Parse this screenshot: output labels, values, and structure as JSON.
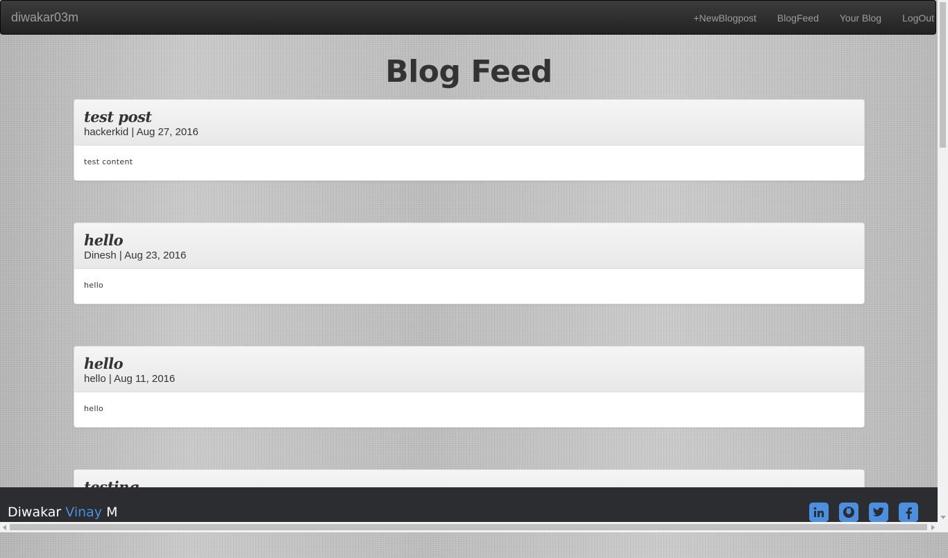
{
  "navbar": {
    "brand": "diwakar03m",
    "links": [
      {
        "label": "+NewBlogpost"
      },
      {
        "label": "BlogFeed"
      },
      {
        "label": "Your Blog"
      },
      {
        "label": "LogOut"
      }
    ]
  },
  "page": {
    "title": "Blog Feed"
  },
  "posts": [
    {
      "title": "test post",
      "author": "hackerkid",
      "date": "Aug 27, 2016",
      "meta": "hackerkid | Aug 27, 2016",
      "content": "test content"
    },
    {
      "title": "hello",
      "author": "Dinesh",
      "date": "Aug 23, 2016",
      "meta": "Dinesh | Aug 23, 2016",
      "content": "hello"
    },
    {
      "title": "hello",
      "author": "hello",
      "date": "Aug 11, 2016",
      "meta": "hello | Aug 11, 2016",
      "content": "hello"
    },
    {
      "title": "testing"
    }
  ],
  "footer": {
    "name_first": "Diwakar",
    "name_middle": "Vinay",
    "name_last": "M",
    "social": [
      {
        "icon": "linkedin-icon"
      },
      {
        "icon": "github-icon"
      },
      {
        "icon": "twitter-icon"
      },
      {
        "icon": "facebook-icon"
      }
    ]
  },
  "colors": {
    "navbar": "#222222",
    "nav_text": "#9d9d9d",
    "footer": "#2b2d30",
    "accent": "#4a8fe0",
    "title": "#333333"
  }
}
